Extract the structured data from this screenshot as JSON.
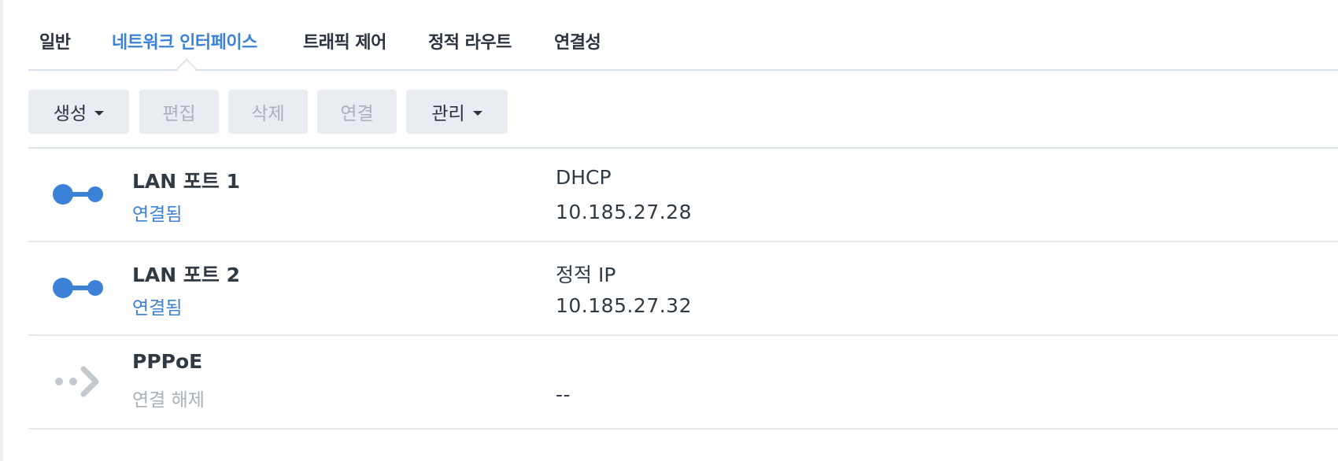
{
  "tabs": [
    {
      "label": "일반",
      "active": false
    },
    {
      "label": "네트워크 인터페이스",
      "active": true
    },
    {
      "label": "트래픽 제어",
      "active": false
    },
    {
      "label": "정적 라우트",
      "active": false
    },
    {
      "label": "연결성",
      "active": false
    }
  ],
  "toolbar": {
    "create_label": "생성",
    "edit_label": "편집",
    "delete_label": "삭제",
    "connect_label": "연결",
    "manage_label": "관리"
  },
  "interfaces": [
    {
      "name": "LAN 포트 1",
      "status": "연결됨",
      "type": "DHCP",
      "ip": "10.185.27.28",
      "icon": "connected-port-icon"
    },
    {
      "name": "LAN 포트 2",
      "status": "연결됨",
      "type": "정적 IP",
      "ip": "10.185.27.32",
      "icon": "connected-port-icon"
    },
    {
      "name": "PPPoE",
      "status": "연결 해제",
      "type": "",
      "ip": "--",
      "icon": "pppoe-disconnected-icon"
    }
  ],
  "colors": {
    "accent": "#3b82d6",
    "muted": "#a8b1ba",
    "button_bg": "#e9edf1",
    "icon_disconnected": "#c4c9ce"
  }
}
